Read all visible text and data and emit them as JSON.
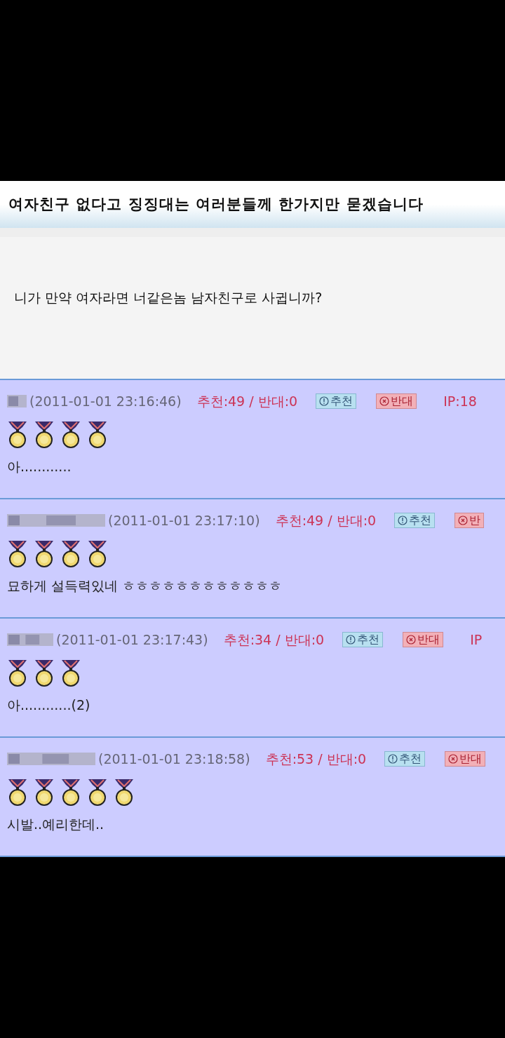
{
  "post": {
    "title": "여자친구 없다고 징징대는 여러분들께 한가지만 묻겠습니다",
    "body": "니가 만약 여자라면 너같은놈 남자친구로 사귑니까?"
  },
  "comments": [
    {
      "date": "(2011-01-01 23:16:46)",
      "votes": "추천:49 / 반대:0",
      "recommend": "추천",
      "oppose": "반대",
      "ip": "IP:18",
      "stars": 4,
      "text": "아............"
    },
    {
      "date": "(2011-01-01 23:17:10)",
      "votes": "추천:49 / 반대:0",
      "recommend": "추천",
      "oppose": "반",
      "stars": 4,
      "text": "묘하게 설득력있네 ㅎㅎㅎㅎㅎㅎㅎㅎㅎㅎㅎㅎ"
    },
    {
      "date": "(2011-01-01 23:17:43)",
      "votes": "추천:34 / 반대:0",
      "recommend": "추천",
      "oppose": "반대",
      "ip": "IP",
      "stars": 3,
      "text": "아............(2)"
    },
    {
      "date": "(2011-01-01 23:18:58)",
      "votes": "추천:53 / 반대:0",
      "recommend": "추천",
      "oppose": "반대",
      "stars": 5,
      "text": "시발..예리한데.."
    }
  ]
}
